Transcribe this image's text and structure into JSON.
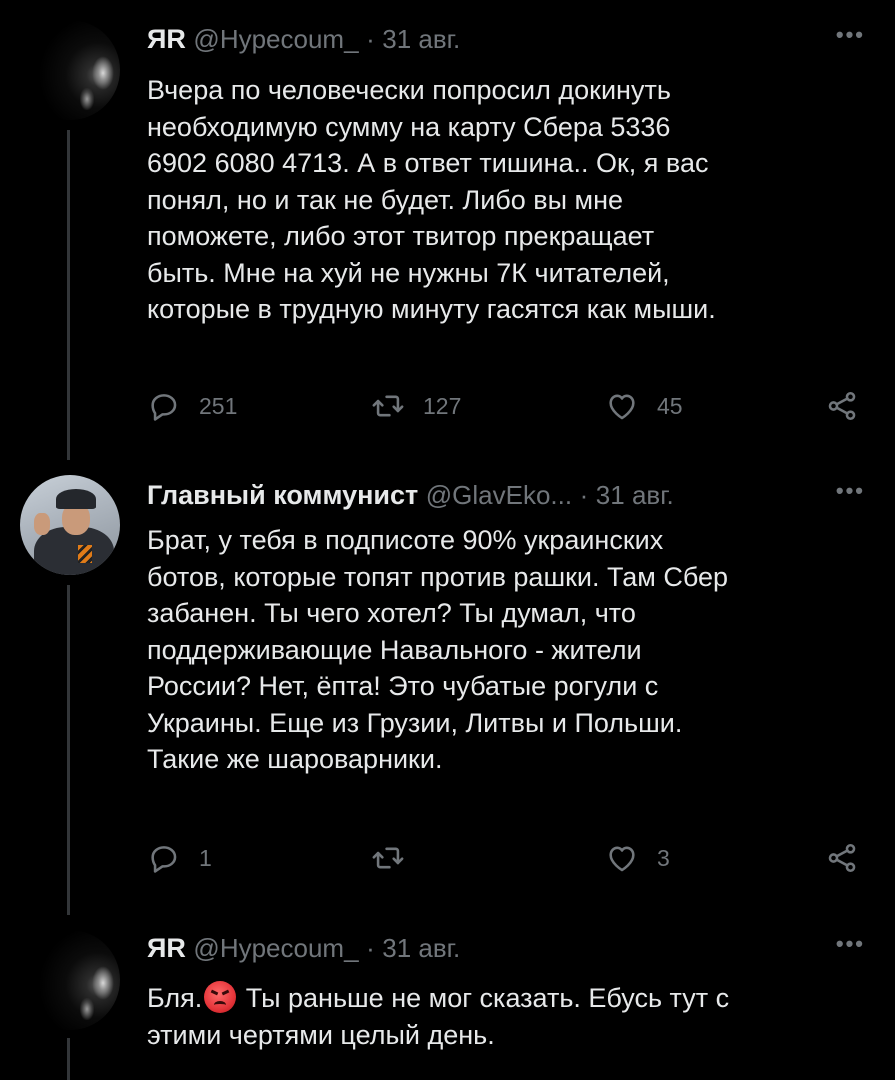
{
  "tweets": [
    {
      "author_name": "ЯR",
      "handle": "@Hypecoum_",
      "separator": "·",
      "date": "31 авг.",
      "text": "Вчера по человечески попросил докинуть\nнеобходимую сумму на карту Сбера 5336\n6902 6080 4713. А в ответ тишина.. Ок, я вас\nпонял, но и так не будет. Либо вы мне\nпоможете, либо этот твитор прекращает\nбыть. Мне на хуй не нужны 7К читателей,\nкоторые в трудную минуту гасятся как мыши.",
      "replies": "251",
      "retweets": "127",
      "likes": "45",
      "avatar_icon": "dark-avatar"
    },
    {
      "author_name": "Главный коммунист",
      "handle": "@GlavEko...",
      "separator": "·",
      "date": "31 авг.",
      "text": "Брат, у тебя в подписоте 90% украинских\nботов, которые топят против рашки. Там Сбер\nзабанен. Ты чего хотел? Ты думал, что\nподдерживающие Навального - жители\nРоссии? Нет, ёпта! Это чубатые рогули с\nУкраины. Еще из Грузии, Литвы и Польши.\nТакие же шароварники.",
      "replies": "1",
      "retweets": "",
      "likes": "3",
      "avatar_icon": "photo-avatar"
    },
    {
      "author_name": "ЯR",
      "handle": "@Hypecoum_",
      "separator": "·",
      "date": "31 авг.",
      "text_before_emoji": "Бля.",
      "emoji": "angry-face-emoji",
      "text_after_emoji": " Ты раньше не мог сказать. Ебусь тут с\nэтими чертями целый день.",
      "avatar_icon": "dark-avatar"
    }
  ],
  "icons": {
    "more": "more-icon",
    "reply": "reply-icon",
    "retweet": "retweet-icon",
    "like": "heart-icon",
    "share": "share-icon"
  },
  "more_label": "•••",
  "colors": {
    "background": "#000000",
    "text": "#e7e9ea",
    "secondary": "#71767b",
    "thread_line": "#333639"
  }
}
